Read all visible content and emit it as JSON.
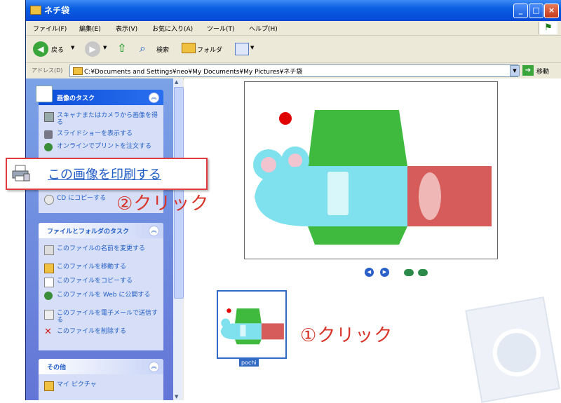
{
  "window": {
    "title": "ネチ袋"
  },
  "menu": [
    "ファイル(F)",
    "編集(E)",
    "表示(V)",
    "お気に入り(A)",
    "ツール(T)",
    "ヘルプ(H)"
  ],
  "toolbar": {
    "back": "戻る",
    "search": "検索",
    "folders": "フォルダ"
  },
  "address": {
    "label": "アドレス(D)",
    "value": "C:¥Documents and Settings¥neo¥My Documents¥My Pictures¥ネチ袋",
    "go": "移動"
  },
  "sidebar": {
    "image_tasks": {
      "title": "画像のタスク",
      "items": [
        "スキャナまたはカメラから画像を得る",
        "スライドショーを表示する",
        "オンラインでプリントを注文する",
        "CD にコピーする"
      ]
    },
    "file_tasks": {
      "title": "ファイルとフォルダのタスク",
      "items": [
        "このファイルの名前を変更する",
        "このファイルを移動する",
        "このファイルをコピーする",
        "このファイルを Web に公開する",
        "このファイルを電子メールで送信する",
        "このファイルを削除する"
      ]
    },
    "other": {
      "title": "その他",
      "items": [
        "マイ ピクチャ"
      ]
    }
  },
  "thumbnail": {
    "caption": "pochi"
  },
  "callout": {
    "print_link": "この画像を印刷する"
  },
  "annotations": {
    "step1": "①クリック",
    "step2": "②クリック"
  },
  "colors": {
    "annotation": "#d8342a",
    "callout_border": "#e23b3b",
    "xp_blue": "#0a5ee0",
    "link": "#215dc6"
  }
}
